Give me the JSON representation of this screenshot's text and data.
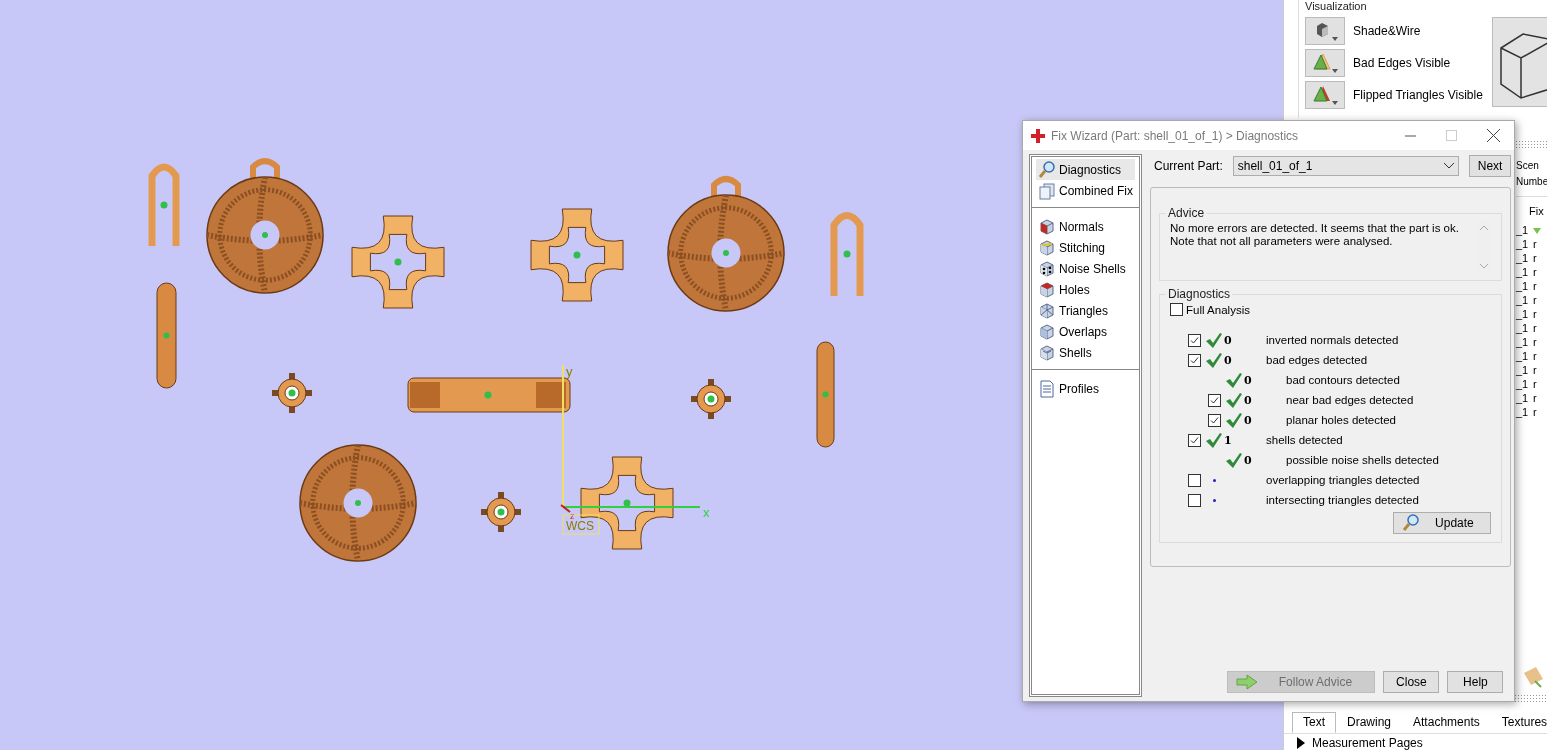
{
  "viewport": {
    "axes": {
      "x": "x",
      "y": "y",
      "z": "z",
      "frame": "WCS"
    }
  },
  "side_panel": {
    "section_title": "Visualization",
    "modes": [
      {
        "label": "Shade&Wire",
        "kind": "shade"
      },
      {
        "label": "Bad Edges Visible",
        "kind": "bad-edges"
      },
      {
        "label": "Flipped Triangles Visible",
        "kind": "flipped"
      }
    ],
    "table": {
      "header_lines": [
        "Scen",
        "Numbe"
      ],
      "column_header": "Fix",
      "rows": [
        {
          "cell": "_1",
          "kind": "icon"
        },
        {
          "cell": "_1",
          "kind": "text",
          "value": "r"
        },
        {
          "cell": "_1",
          "kind": "text",
          "value": "r"
        },
        {
          "cell": "_1",
          "kind": "text",
          "value": "r"
        },
        {
          "cell": "_1",
          "kind": "text",
          "value": "r"
        },
        {
          "cell": "_1",
          "kind": "text",
          "value": "r"
        },
        {
          "cell": "_1",
          "kind": "text",
          "value": "r"
        },
        {
          "cell": "_1",
          "kind": "text",
          "value": "r"
        },
        {
          "cell": "_1",
          "kind": "text",
          "value": "r"
        },
        {
          "cell": "_1",
          "kind": "text",
          "value": "r"
        },
        {
          "cell": "_1",
          "kind": "text",
          "value": "r"
        },
        {
          "cell": "_1",
          "kind": "text",
          "value": "r"
        },
        {
          "cell": "_1",
          "kind": "text",
          "value": "r"
        },
        {
          "cell": "_1",
          "kind": "text",
          "value": "r"
        }
      ]
    },
    "tabs": [
      {
        "label": "Text",
        "selected": true
      },
      {
        "label": "Drawing",
        "selected": false
      },
      {
        "label": "Attachments",
        "selected": false
      },
      {
        "label": "Textures",
        "selected": false
      }
    ],
    "tree_item": {
      "label": "Measurement Pages",
      "expanded": false
    }
  },
  "dialog": {
    "title": "Fix Wizard (Part: shell_01_of_1) > Diagnostics",
    "nav_groups": [
      [
        {
          "label": "Diagnostics",
          "selected": true
        },
        {
          "label": "Combined Fix",
          "selected": false
        }
      ],
      [
        {
          "label": "Normals",
          "selected": false
        },
        {
          "label": "Stitching",
          "selected": false
        },
        {
          "label": "Noise Shells",
          "selected": false
        },
        {
          "label": "Holes",
          "selected": false
        },
        {
          "label": "Triangles",
          "selected": false
        },
        {
          "label": "Overlaps",
          "selected": false
        },
        {
          "label": "Shells",
          "selected": false
        }
      ],
      [
        {
          "label": "Profiles",
          "selected": false
        }
      ]
    ],
    "current_part": {
      "label": "Current Part:",
      "value": "shell_01_of_1"
    },
    "next_button": "Next",
    "advice": {
      "title": "Advice",
      "lines": [
        "No more errors are detected. It seems that the part is ok.",
        "Note that not all parameters were analysed."
      ]
    },
    "diagnostics": {
      "title": "Diagnostics",
      "full_analysis": {
        "label": "Full Analysis",
        "checked": false
      },
      "items": [
        {
          "kind": "checkable",
          "checked": true,
          "passed": true,
          "count": "0",
          "label": "inverted normals detected"
        },
        {
          "kind": "checkable",
          "checked": true,
          "passed": true,
          "count": "0",
          "label": "bad edges detected",
          "children": [
            {
              "kind": "plain",
              "passed": true,
              "count": "0",
              "label": "bad contours detected"
            },
            {
              "kind": "checkable",
              "checked": true,
              "passed": true,
              "count": "0",
              "label": "near bad edges detected"
            },
            {
              "kind": "checkable",
              "checked": true,
              "passed": true,
              "count": "0",
              "label": "planar holes detected"
            }
          ]
        },
        {
          "kind": "checkable",
          "checked": true,
          "passed": true,
          "count": "1",
          "label": "shells detected",
          "children": [
            {
              "kind": "plain",
              "passed": true,
              "count": "0",
              "label": "possible noise shells detected"
            }
          ]
        },
        {
          "kind": "checkable",
          "checked": false,
          "passed": false,
          "label": "overlapping triangles detected"
        },
        {
          "kind": "checkable",
          "checked": false,
          "passed": false,
          "label": "intersecting triangles detected"
        }
      ],
      "update_button": "Update"
    },
    "buttons": [
      {
        "label": "Follow Advice",
        "kind": "arrow",
        "disabled": true
      },
      {
        "label": "Close",
        "kind": "plain",
        "disabled": false
      },
      {
        "label": "Help",
        "kind": "plain",
        "disabled": false
      }
    ]
  }
}
